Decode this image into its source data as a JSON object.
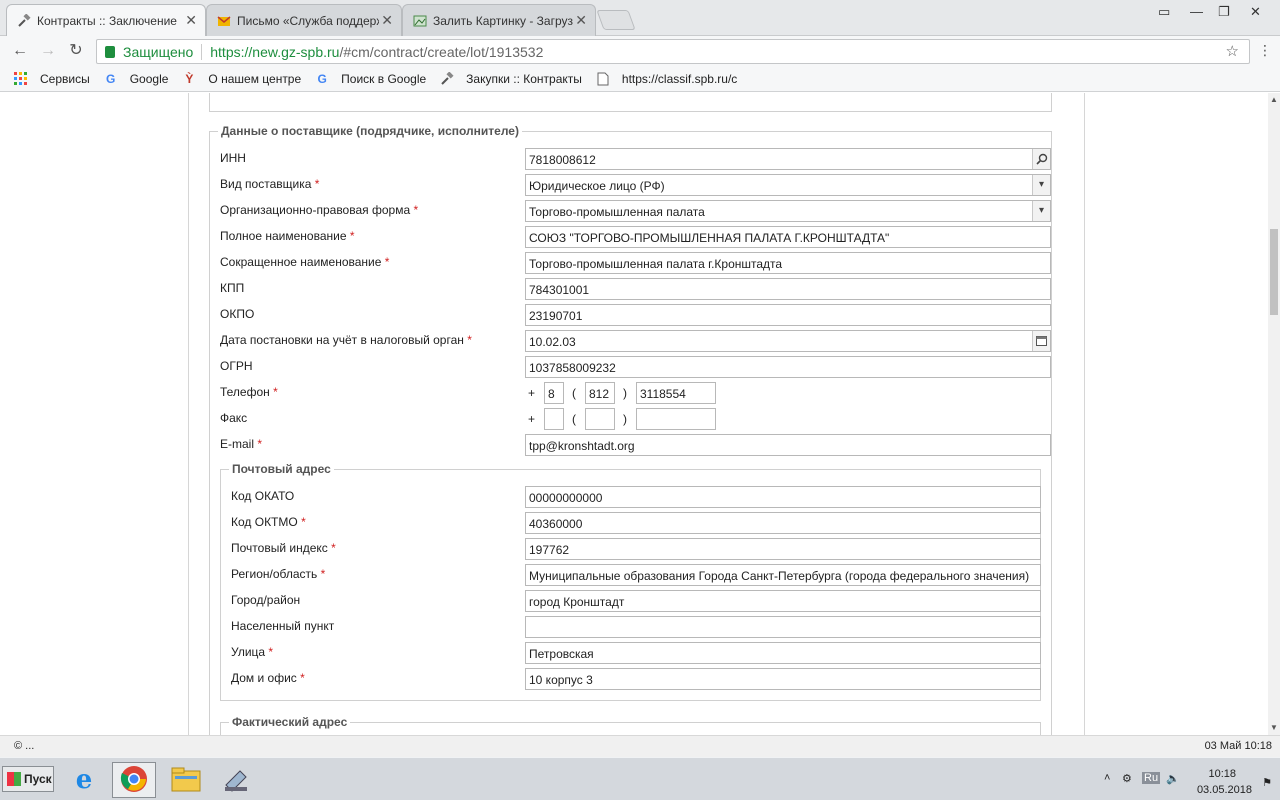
{
  "tabs": [
    {
      "title": "Контракты :: Заключение",
      "icon": "hammer-icon",
      "active": true
    },
    {
      "title": "Письмо «Служба поддерж",
      "icon": "mail-icon",
      "active": false
    },
    {
      "title": "Залить Картинку - Загрузи",
      "icon": "image-icon",
      "active": false
    }
  ],
  "addressbar": {
    "secure_label": "Защищено",
    "url_scheme": "https://",
    "url_host": "new.gz-spb.ru",
    "url_path": "/#cm/contract/create/lot/1913532"
  },
  "bookmarks": [
    {
      "label": "Сервисы",
      "icon": "apps-icon"
    },
    {
      "label": "Google",
      "icon": "google-icon"
    },
    {
      "label": "О нашем центре",
      "icon": "logo-icon"
    },
    {
      "label": "Поиск в Google",
      "icon": "google-icon"
    },
    {
      "label": "Закупки :: Контракты",
      "icon": "hammer-icon"
    },
    {
      "label": "https://classif.spb.ru/c",
      "icon": "page-icon"
    }
  ],
  "supplier": {
    "legend": "Данные о поставщике (подрядчике, исполнителе)",
    "inn_label": "ИНН",
    "inn_value": "7818008612",
    "type_label": "Вид поставщика",
    "type_value": "Юридическое лицо (РФ)",
    "legal_form_label": "Организационно-правовая форма",
    "legal_form_value": "Торгово-промышленная палата",
    "full_name_label": "Полное наименование",
    "full_name_value": "СОЮЗ \"ТОРГОВО-ПРОМЫШЛЕННАЯ ПАЛАТА Г.КРОНШТАДТА\"",
    "short_name_label": "Сокращенное наименование",
    "short_name_value": "Торгово-промышленная палата г.Кронштадта",
    "kpp_label": "КПП",
    "kpp_value": "784301001",
    "okpo_label": "ОКПО",
    "okpo_value": "23190701",
    "tax_date_label": "Дата постановки на учёт в налоговый орган",
    "tax_date_value": "10.02.03",
    "ogrn_label": "ОГРН",
    "ogrn_value": "1037858009232",
    "phone_label": "Телефон",
    "phone_plus": "+",
    "phone_country": "8",
    "phone_open": "(",
    "phone_code": "812",
    "phone_close": ")",
    "phone_number": "3118554",
    "fax_label": "Факс",
    "fax_plus": "+",
    "fax_country": "",
    "fax_open": "(",
    "fax_code": "",
    "fax_close": ")",
    "fax_number": "",
    "email_label": "E-mail",
    "email_value": "tpp@kronshtadt.org",
    "required_mark": "*"
  },
  "postal": {
    "legend": "Почтовый адрес",
    "okato_label": "Код ОКАТО",
    "okato_value": "00000000000",
    "oktmo_label": "Код ОКТМО",
    "oktmo_value": "40360000",
    "index_label": "Почтовый индекс",
    "index_value": "197762",
    "region_label": "Регион/область",
    "region_value": "Муниципальные образования Города Санкт-Петербурга (города федерального значения)",
    "city_label": "Город/район",
    "city_value": "город Кронштадт",
    "settlement_label": "Населенный пункт",
    "settlement_value": "",
    "street_label": "Улица",
    "street_value": "Петровская",
    "house_label": "Дом и офис",
    "house_value": "10 корпус 3"
  },
  "actual": {
    "legend": "Фактический адрес"
  },
  "statusbar": {
    "left": "© ...",
    "right": "03 Май 10:18"
  },
  "taskbar": {
    "start_label": "Пуск",
    "lang": "Ru",
    "time": "10:18",
    "date": "03.05.2018"
  }
}
